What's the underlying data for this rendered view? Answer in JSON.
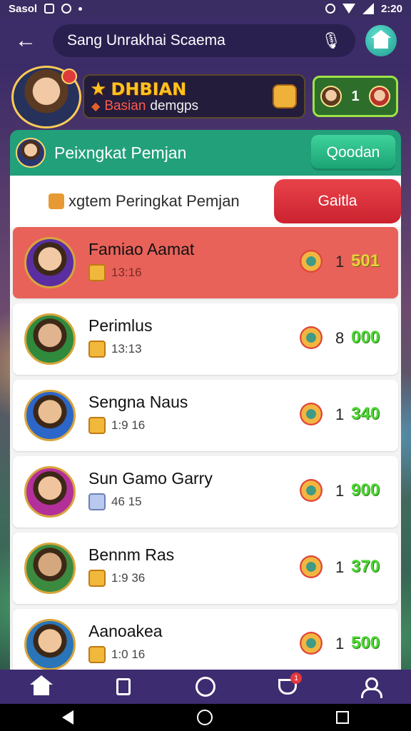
{
  "status_bar": {
    "carrier": "Sasol",
    "time": "2:20"
  },
  "header": {
    "title": "Sang Unrakhai Scaema"
  },
  "profile": {
    "rank_title": "DHBIAN",
    "rank_sub_red": "Basian",
    "rank_sub_white": "demgps",
    "coins": "1"
  },
  "leaderboard": {
    "title": "Peixngkat Pemjan",
    "header_button": "Qoodan",
    "tab_left": "xgtem Peringkat Pemjan",
    "tab_right": "Gaitla",
    "rows": [
      {
        "name": "Famiao Aamat",
        "sub": "13:16",
        "rank": "1",
        "score": "501",
        "highlight": true,
        "avatar_colors": [
          "#5a2ea0",
          "#f1c9a4"
        ]
      },
      {
        "name": "Perimlus",
        "sub": "13:13",
        "rank": "8",
        "score": "000",
        "highlight": false,
        "avatar_colors": [
          "#2f8a3c",
          "#e0b48f"
        ]
      },
      {
        "name": "Sengna Naus",
        "sub": "1:9 16",
        "rank": "1",
        "score": "340",
        "highlight": false,
        "avatar_colors": [
          "#2c66c9",
          "#e9be93"
        ]
      },
      {
        "name": "Sun Gamo Garry",
        "sub": "46 15",
        "rank": "1",
        "score": "900",
        "highlight": false,
        "avatar_colors": [
          "#b3309a",
          "#f0c49c"
        ]
      },
      {
        "name": "Bennm Ras",
        "sub": "1:9 36",
        "rank": "1",
        "score": "370",
        "highlight": false,
        "avatar_colors": [
          "#3c8a40",
          "#d5a77e"
        ]
      },
      {
        "name": "Aanoakea",
        "sub": "1:0 16",
        "rank": "1",
        "score": "500",
        "highlight": false,
        "avatar_colors": [
          "#2a74b8",
          "#efc59c"
        ]
      }
    ]
  },
  "bottom_nav": {
    "notification_count": "1"
  },
  "colors": {
    "header_bg": "#3c2d68",
    "leaderboard_green": "#22a07a",
    "tab_red": "#cc2230",
    "highlight_row": "#e8625a",
    "score_green": "#4dd634"
  },
  "icons": [
    "back-arrow-icon",
    "mic-icon",
    "house-icon",
    "star-icon",
    "shield-icon",
    "cat-icon",
    "trophy-icon",
    "badge-icon",
    "home-icon",
    "bag-icon",
    "circle-icon",
    "user-icon"
  ]
}
